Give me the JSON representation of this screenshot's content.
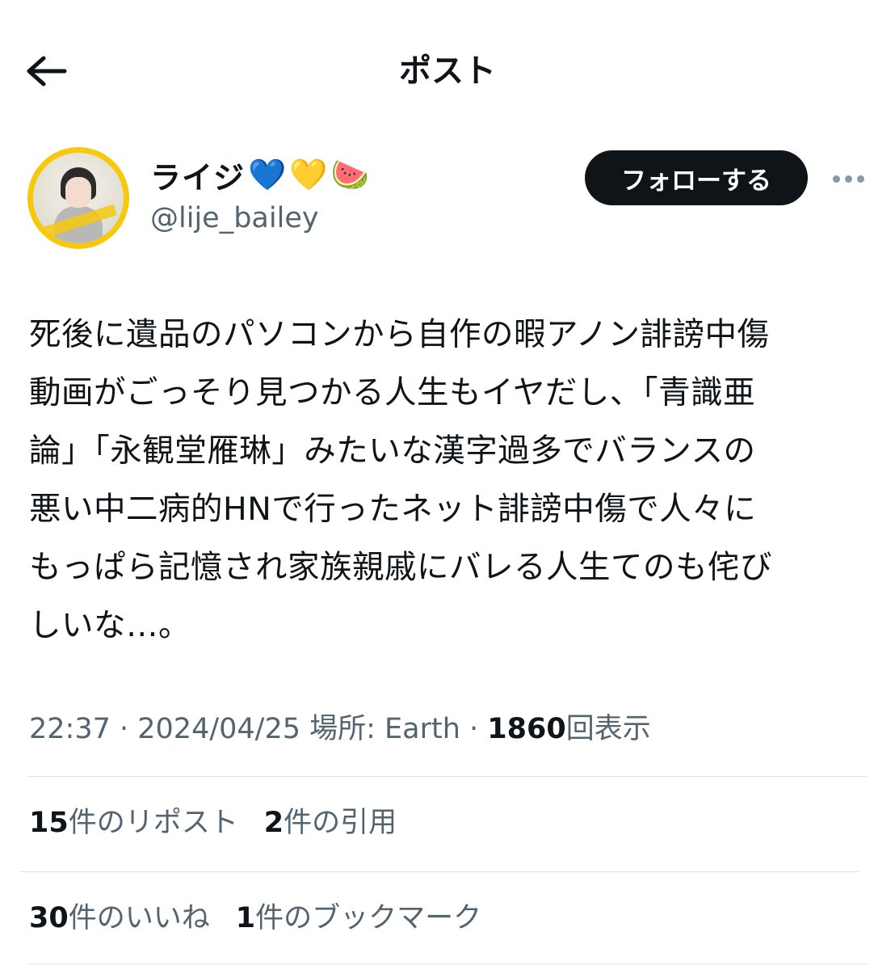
{
  "header": {
    "title": "ポスト",
    "back_icon": "arrow-left-icon"
  },
  "author": {
    "display_name": "ライジ",
    "name_emojis": [
      "💙",
      "💛",
      "🍉"
    ],
    "handle": "@lije_bailey",
    "follow_label": "フォローする",
    "more_icon": "more-dots-icon"
  },
  "post": {
    "text": "死後に遺品のパソコンから自作の暇アノン誹謗中傷\n動画がごっそり見つかる人生もイヤだし、「青識亜\n論」「永観堂雁琳」みたいな漢字過多でバランスの\n悪い中二病的HNで行ったネット誹謗中傷で人々に\nもっぱら記憶され家族親戚にバレる人生てのも侘び\nしいな…。"
  },
  "meta": {
    "time": "22:37",
    "sep1": " · ",
    "date": "2024/04/25",
    "location": " 場所: Earth",
    "sep2": " · ",
    "views_count": "1860",
    "views_label": "回表示"
  },
  "stats": {
    "reposts_count": "15",
    "reposts_label": "件のリポスト",
    "quotes_count": "2",
    "quotes_label": "件の引用",
    "likes_count": "30",
    "likes_label": "件のいいね",
    "bookmarks_count": "1",
    "bookmarks_label": "件のブックマーク"
  },
  "colors": {
    "text_primary": "#0f1419",
    "text_secondary": "#536471",
    "follow_bg": "#0f1419",
    "avatar_ring": "#f6c90e",
    "divider": "#dfe3e6"
  }
}
